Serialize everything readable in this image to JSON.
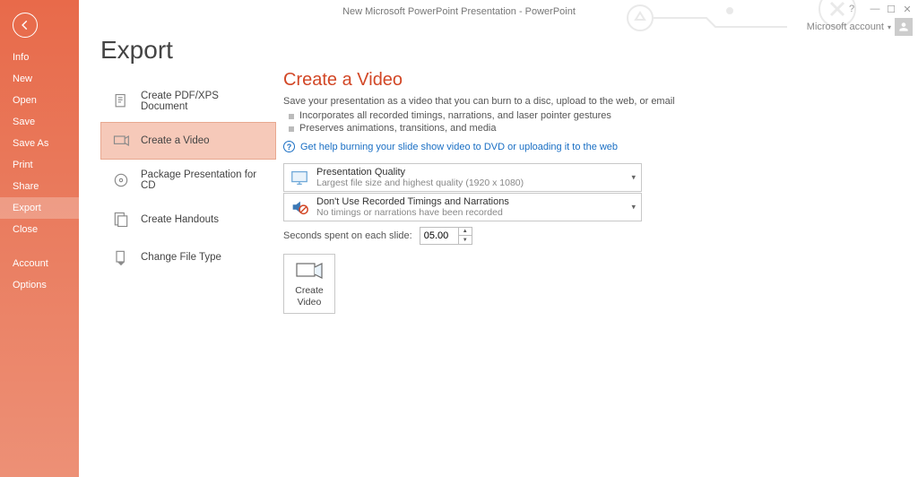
{
  "titlebar": {
    "title": "New Microsoft PowerPoint Presentation - PowerPoint"
  },
  "account": {
    "label": "Microsoft account"
  },
  "sidebar": {
    "items": [
      {
        "key": "info",
        "label": "Info"
      },
      {
        "key": "new",
        "label": "New"
      },
      {
        "key": "open",
        "label": "Open"
      },
      {
        "key": "save",
        "label": "Save"
      },
      {
        "key": "save-as",
        "label": "Save As"
      },
      {
        "key": "print",
        "label": "Print"
      },
      {
        "key": "share",
        "label": "Share"
      },
      {
        "key": "export",
        "label": "Export",
        "active": true
      },
      {
        "key": "close",
        "label": "Close"
      },
      {
        "key": "account",
        "label": "Account"
      },
      {
        "key": "options",
        "label": "Options"
      }
    ]
  },
  "export": {
    "title": "Export",
    "items": [
      {
        "key": "pdf",
        "label": "Create PDF/XPS Document"
      },
      {
        "key": "video",
        "label": "Create a Video",
        "selected": true
      },
      {
        "key": "cd",
        "label": "Package Presentation for CD"
      },
      {
        "key": "handouts",
        "label": "Create Handouts"
      },
      {
        "key": "filetype",
        "label": "Change File Type"
      }
    ]
  },
  "video": {
    "heading": "Create a Video",
    "description": "Save your presentation as a video that you can burn to a disc, upload to the web, or email",
    "bullets": [
      "Incorporates all recorded timings, narrations, and laser pointer gestures",
      "Preserves animations, transitions, and media"
    ],
    "help_link": "Get help burning your slide show video to DVD or uploading it to the web",
    "quality": {
      "title": "Presentation Quality",
      "subtitle": "Largest file size and highest quality (1920 x 1080)"
    },
    "timings": {
      "title": "Don't Use Recorded Timings and Narrations",
      "subtitle": "No timings or narrations have been recorded"
    },
    "seconds_label": "Seconds spent on each slide:",
    "seconds_value": "05.00",
    "create_button_l1": "Create",
    "create_button_l2": "Video"
  }
}
